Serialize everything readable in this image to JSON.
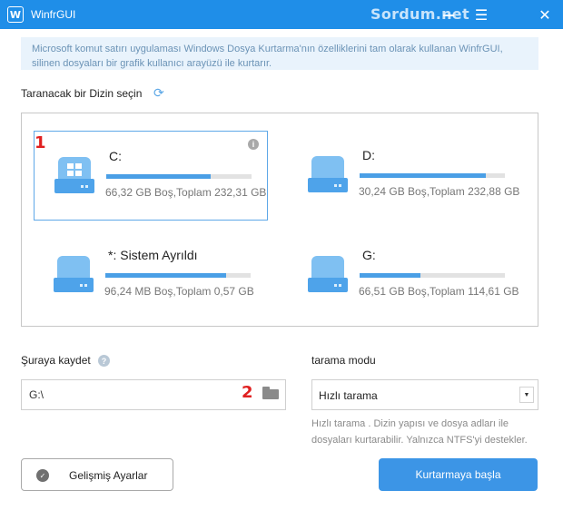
{
  "window": {
    "title": "WinfrGUI",
    "watermark": "Sordum.net",
    "app_icon_glyph": "W",
    "controls": [
      "minimize-icon",
      "menu-icon",
      "close-icon"
    ]
  },
  "info_banner": "Microsoft komut satırı uygulaması Windows Dosya Kurtarma'nın özelliklerini tam olarak kullanan WinfrGUI, silinen dosyaları bir grafik kullanıcı arayüzü ile kurtarır.",
  "scan_dir": {
    "label": "Taranacak bir Dizin seçin",
    "drives": [
      {
        "name": "C:",
        "size": "66,32 GB Boş,Toplam 232,31 GB",
        "used_fraction": 0.72,
        "selected": true,
        "system_drive": true,
        "marker": "1"
      },
      {
        "name": "D:",
        "size": "30,24 GB Boş,Toplam 232,88 GB",
        "used_fraction": 0.87,
        "selected": false,
        "system_drive": false
      },
      {
        "name": "*: Sistem Ayrıldı",
        "size": "96,24 MB Boş,Toplam 0,57 GB",
        "used_fraction": 0.83,
        "selected": false,
        "system_drive": false
      },
      {
        "name": "G:",
        "size": "66,51 GB Boş,Toplam 114,61 GB",
        "used_fraction": 0.42,
        "selected": false,
        "system_drive": false
      }
    ]
  },
  "save": {
    "label": "Şuraya kaydet",
    "path_value": "G:\\",
    "marker": "2"
  },
  "scan_mode": {
    "label": "tarama modu",
    "selected": "Hızlı tarama",
    "description": "Hızlı tarama . Dizin yapısı ve dosya adları ile dosyaları kurtarabilir. Yalnızca NTFS'yi destekler."
  },
  "buttons": {
    "advanced": "Gelişmiş Ayarlar",
    "start": "Kurtarmaya başla"
  },
  "colors": {
    "titlebar": "#1f8ee8",
    "accent": "#3c95e6",
    "marker": "#e02020"
  }
}
